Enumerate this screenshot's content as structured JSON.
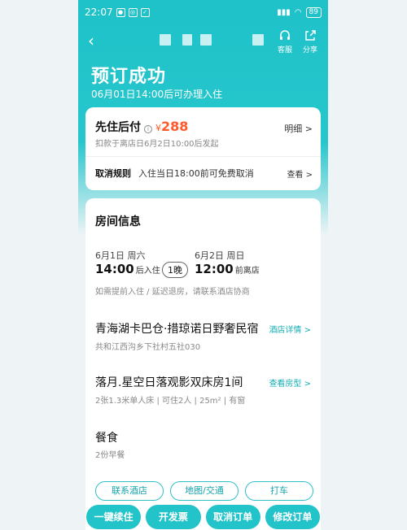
{
  "status_bar": {
    "time": "22:07",
    "battery": "89"
  },
  "header": {
    "back_icon": "chevron-left-icon",
    "service_label": "客服",
    "share_label": "分享",
    "title": "预订成功",
    "subtitle": "06月01日14:00后可办理入住"
  },
  "payment": {
    "label": "先住后付",
    "currency": "¥",
    "price": "288",
    "detail_link": "明细 >",
    "note": "扣款于离店日6月2日10:00后发起",
    "cancel_label": "取消规则",
    "cancel_text": "入住当日18:00前可免费取消",
    "view_link": "查看 >"
  },
  "room": {
    "section_title": "房间信息",
    "checkin_day": "6月1日 周六",
    "checkin_time": "14:00",
    "checkin_label": "后入住",
    "nights": "1晚",
    "checkout_day": "6月2日 周日",
    "checkout_time": "12:00",
    "checkout_label": "前离店",
    "stay_note": "如需提前入住 / 延迟退房，请联系酒店协商",
    "hotel_name": "青海湖卡巴仓·措琼诺日野奢民宿",
    "hotel_link": "酒店详情 >",
    "hotel_address": "共和江西沟乡下社村五社030",
    "room_name": "落月.星空日落观影双床房1间",
    "room_link": "查看房型 >",
    "room_specs": "2张1.3米单人床 | 可住2人 | 25m² | 有窗",
    "meal_title": "餐食",
    "meal_note": "2份早餐"
  },
  "chips": [
    "联系酒店",
    "地图/交通",
    "打车"
  ],
  "bottom_buttons": [
    "一键续住",
    "开发票",
    "取消订单",
    "修改订单"
  ],
  "colors": {
    "accent": "#22c3c9",
    "price": "#ff5a2a"
  }
}
